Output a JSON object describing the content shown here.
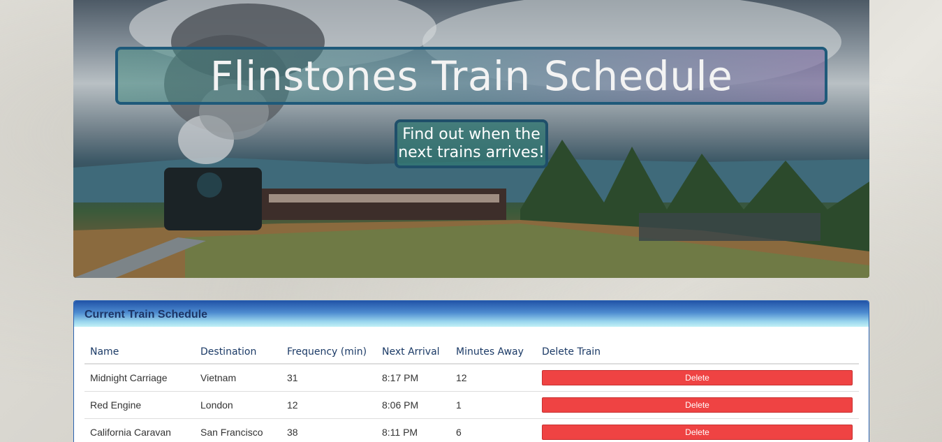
{
  "hero": {
    "title": "Flinstones Train Schedule",
    "subtitle": "Find out when the next trains arrives!"
  },
  "schedule": {
    "heading": "Current Train Schedule",
    "columns": [
      "Name",
      "Destination",
      "Frequency (min)",
      "Next Arrival",
      "Minutes Away",
      "Delete Train"
    ],
    "rows": [
      {
        "name": "Midnight Carriage",
        "destination": "Vietnam",
        "frequency": "31",
        "next_arrival": "8:17 PM",
        "minutes_away": "12",
        "delete_label": "Delete"
      },
      {
        "name": "Red Engine",
        "destination": "London",
        "frequency": "12",
        "next_arrival": "8:06 PM",
        "minutes_away": "1",
        "delete_label": "Delete"
      },
      {
        "name": "California Caravan",
        "destination": "San Francisco",
        "frequency": "38",
        "next_arrival": "8:11 PM",
        "minutes_away": "6",
        "delete_label": "Delete"
      }
    ]
  },
  "colors": {
    "delete_button": "#ef4343",
    "panel_heading_top": "#2254a8",
    "panel_heading_bottom": "#c2f1f6",
    "header_text": "#1b3a66"
  },
  "icons": [
    "train-scene-image"
  ]
}
